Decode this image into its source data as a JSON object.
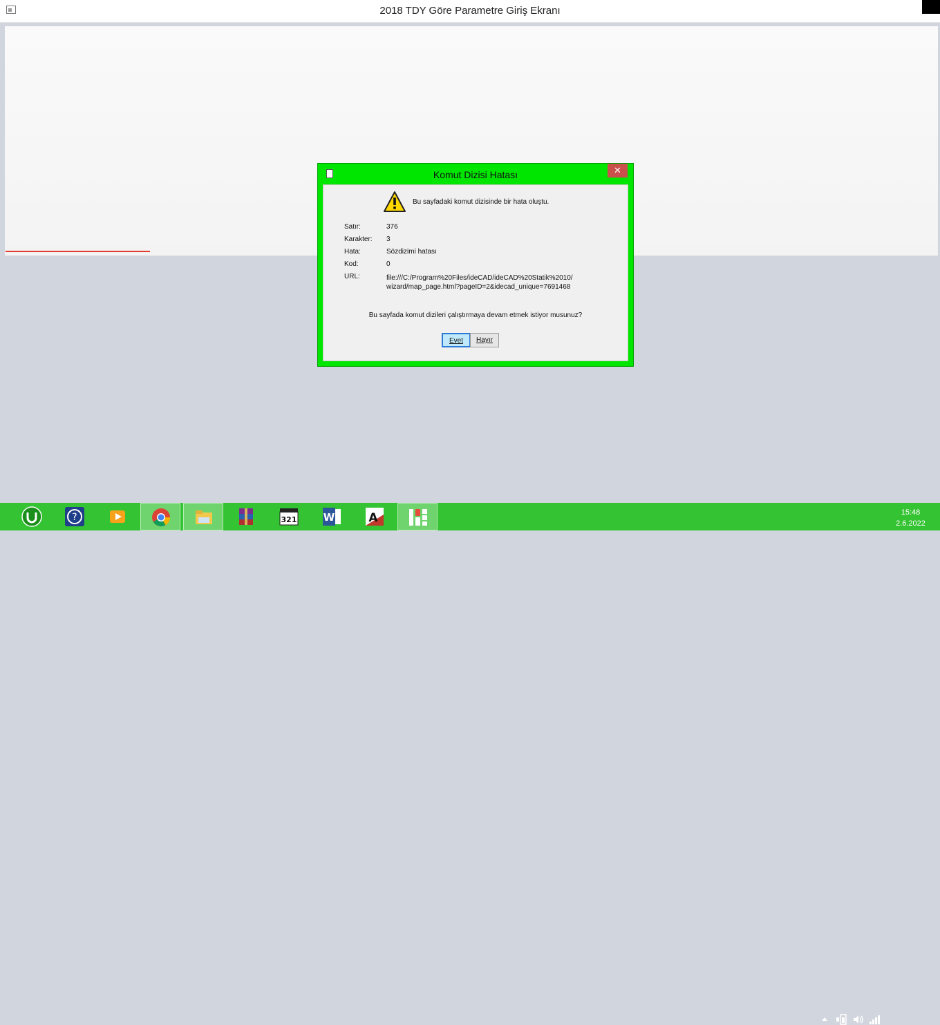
{
  "window": {
    "title": "2018 TDY Göre Parametre Giriş Ekranı"
  },
  "dialog": {
    "title": "Komut Dizisi Hatası",
    "close_glyph": "✕",
    "message": "Bu sayfadaki komut dizisinde bir hata oluştu.",
    "rows": [
      {
        "label": "Satır:",
        "value": "376"
      },
      {
        "label": "Karakter:",
        "value": "3"
      },
      {
        "label": "Hata:",
        "value": "Sözdizimi hatası"
      },
      {
        "label": "Kod:",
        "value": "0"
      }
    ],
    "url_label": "URL:",
    "url_value": "file:///C:/Program%20Files/ideCAD/ideCAD%20Statik%2010/wizard/map_page.html?pageID=2&idecad_unique=7691468",
    "question": "Bu sayfada komut dizileri çalıştırmaya devam etmek istiyor musunuz?",
    "yes_label": "Evet",
    "no_label": "Hayır"
  },
  "taskbar": {
    "accent": "#34c332",
    "apps": [
      {
        "name": "utorrent-icon",
        "active": false
      },
      {
        "name": "help-icon",
        "active": false
      },
      {
        "name": "media-player-icon",
        "active": false
      },
      {
        "name": "chrome-icon",
        "active": true
      },
      {
        "name": "file-explorer-icon",
        "active": true
      },
      {
        "name": "winrar-icon",
        "active": false
      },
      {
        "name": "media-player-classic-icon",
        "active": false
      },
      {
        "name": "word-icon",
        "active": false
      },
      {
        "name": "autocad-icon",
        "active": false
      },
      {
        "name": "idecad-icon",
        "active": true
      }
    ],
    "clock_time": "15:48",
    "clock_date": "2.6.2022"
  }
}
